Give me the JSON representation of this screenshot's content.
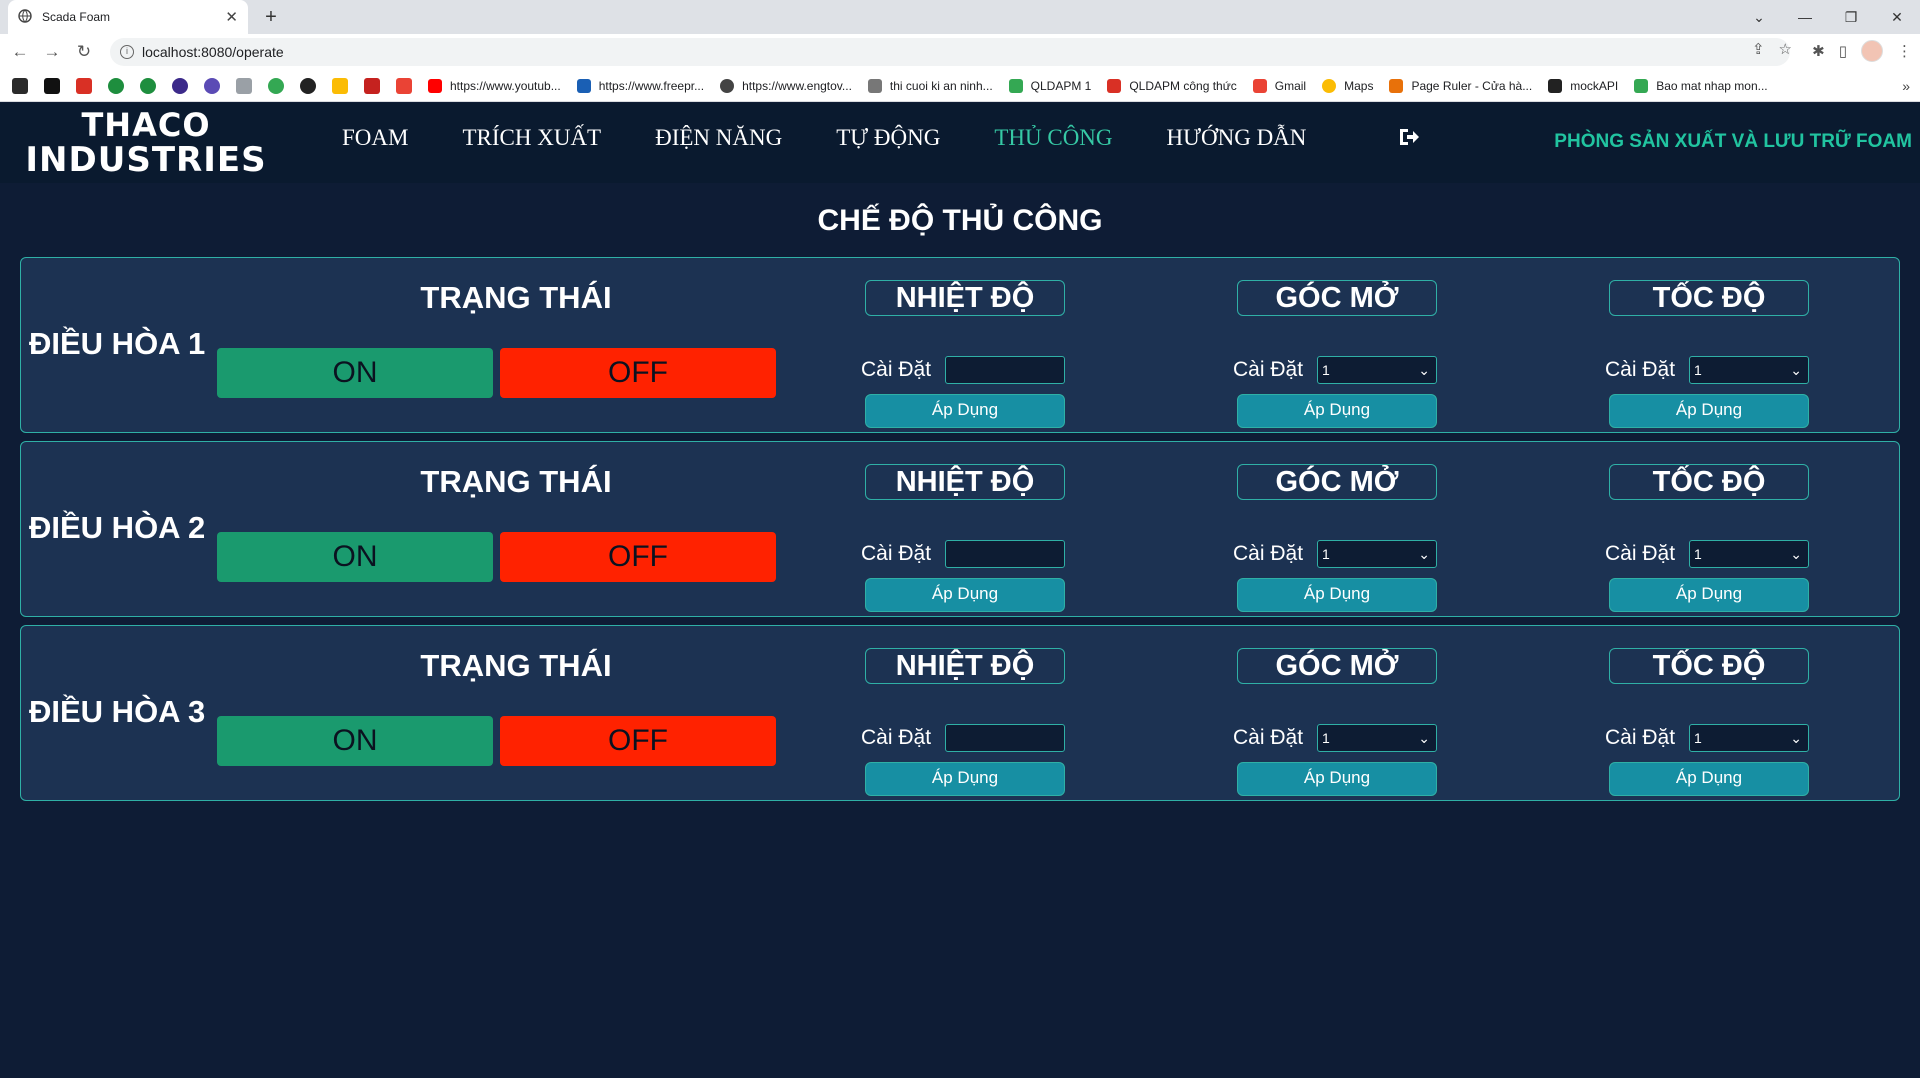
{
  "browser": {
    "tab_title": "Scada Foam",
    "url": "localhost:8080/operate",
    "bookmarks": [
      {
        "label": "https://www.youtub..."
      },
      {
        "label": "https://www.freepr..."
      },
      {
        "label": "https://www.engtov..."
      },
      {
        "label": "thi cuoi ki an ninh..."
      },
      {
        "label": "QLDAPM 1"
      },
      {
        "label": "QLDAPM công thức"
      },
      {
        "label": "Gmail"
      },
      {
        "label": "Maps"
      },
      {
        "label": "Page Ruler - Cửa hà..."
      },
      {
        "label": "mockAPI"
      },
      {
        "label": "Bao mat nhap mon..."
      }
    ]
  },
  "header": {
    "logo_line1": "THACO",
    "logo_line2": "INDUSTRIES",
    "nav": [
      "FOAM",
      "TRÍCH XUẤT",
      "ĐIỆN NĂNG",
      "TỰ ĐỘNG",
      "THỦ CÔNG",
      "HƯỚNG DẪN"
    ],
    "active_nav": "THỦ CÔNG",
    "department": "PHÒNG SẢN XUẤT VÀ LƯU TRỮ FOAM"
  },
  "page": {
    "title": "CHẾ ĐỘ THỦ CÔNG",
    "status_title": "TRẠNG THÁI",
    "on_label": "ON",
    "off_label": "OFF",
    "param_temp": "NHIỆT ĐỘ",
    "param_angle": "GÓC MỞ",
    "param_speed": "TỐC ĐỘ",
    "setting_label": "Cài Đặt",
    "apply_label": "Áp Dụng",
    "units": [
      {
        "name": "ĐIỀU HÒA 1",
        "temp_value": "",
        "angle_value": "1",
        "speed_value": "1"
      },
      {
        "name": "ĐIỀU HÒA 2",
        "temp_value": "",
        "angle_value": "1",
        "speed_value": "1"
      },
      {
        "name": "ĐIỀU HÒA 3",
        "temp_value": "",
        "angle_value": "1",
        "speed_value": "1"
      }
    ]
  },
  "colors": {
    "background": "#0e1c35",
    "panel": "#1c3252",
    "accent_teal": "#2fb0a6",
    "on_green": "#1a9a6e",
    "off_red": "#ff2200",
    "nav_active": "#36c9a5"
  }
}
